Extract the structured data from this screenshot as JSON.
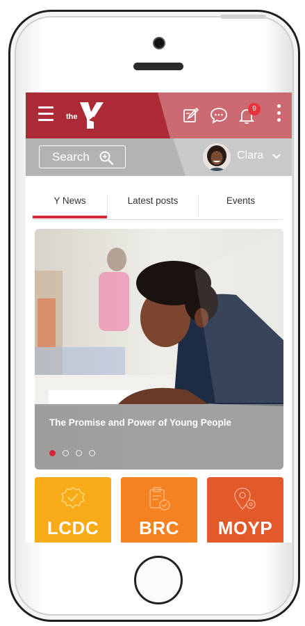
{
  "app": {
    "logo_prefix": "the",
    "notification_count": "9",
    "accent": "#ab2a35"
  },
  "header": {
    "icons": [
      "menu-icon",
      "edit-icon",
      "chat-icon",
      "bell-icon",
      "more-vertical-icon"
    ]
  },
  "search": {
    "label": "Search"
  },
  "user": {
    "name": "Clara"
  },
  "tabs": [
    {
      "label": "Y News",
      "active": true
    },
    {
      "label": "Latest posts",
      "active": false
    },
    {
      "label": "Events",
      "active": false
    }
  ],
  "hero": {
    "title": "The Promise and Power of Young People",
    "slide_count": 4,
    "active_slide": 1
  },
  "tiles": [
    {
      "label": "LCDC",
      "color": "#f8ab18",
      "icon": "badge-check-icon"
    },
    {
      "label": "BRC",
      "color": "#f58220",
      "icon": "clipboard-check-icon"
    },
    {
      "label": "MOYP",
      "color": "#e2592a",
      "icon": "location-gear-icon"
    }
  ]
}
